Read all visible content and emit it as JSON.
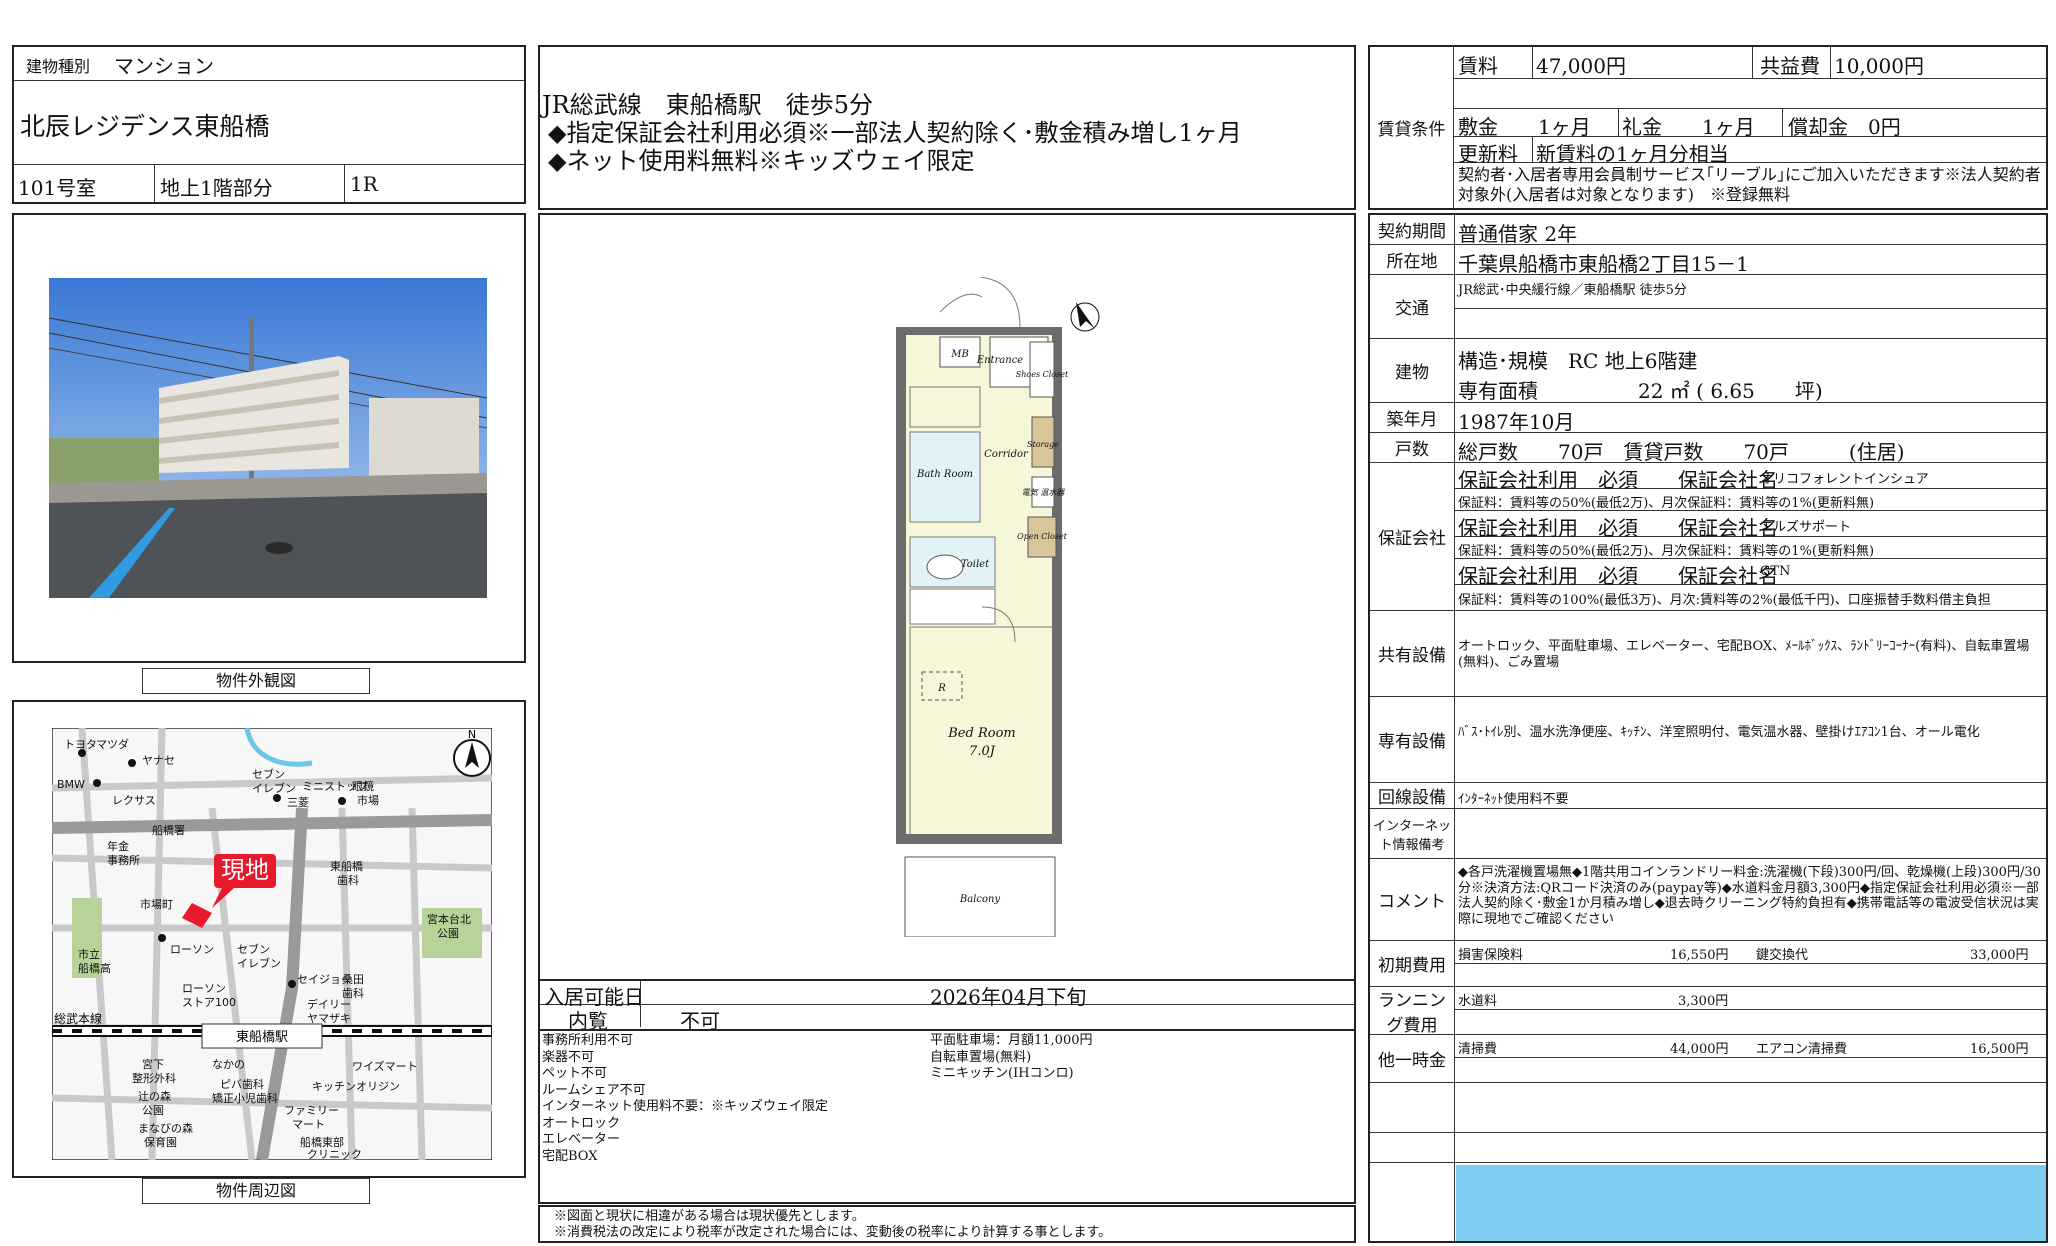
{
  "building": {
    "type_label": "建物種別",
    "type_value": "マンション",
    "name": "北辰レジデンス東船橋",
    "room": "101号室",
    "floor": "地上1階部分",
    "layout": "1R"
  },
  "access": {
    "line1": "JR総武線　東船橋駅　徒歩5分",
    "line2": "◆指定保証会社利用必須※一部法人契約除く･敷金積み増し1ヶ月",
    "line3": "◆ネット使用料無料※キッズウェイ限定"
  },
  "photo_caption": "物件外観図",
  "map_caption": "物件周辺図",
  "map": {
    "current_location": "現地",
    "station": "東船橋駅",
    "line": "総武本線",
    "labels": [
      "トヨタ",
      "マツダ",
      "ヤナセ",
      "BMW",
      "レクサス",
      "セブン イレブン",
      "三菱",
      "ミニ ストップ",
      "眼鏡 市場",
      "船橋署",
      "年金 事務所",
      "東船橋 歯科",
      "市場町",
      "宮本台北 公園",
      "市立 船橋高",
      "ローソン",
      "セブン イレブン",
      "ローソン ストア100",
      "セイジョー",
      "桑田 歯科",
      "デイリー ヤマザキ",
      "宮下 整形外科",
      "なかの",
      "ワイズマート",
      "ピバ歯科 矯正小児歯科",
      "キッチンオリジン",
      "辻の森 公園",
      "ファミリー マート",
      "まなびの森 保育園",
      "船橋東部 クリニック"
    ]
  },
  "floorplan": {
    "rooms": [
      "MB",
      "Entrance",
      "Shoes Closet",
      "Bath Room",
      "Corridor",
      "Storage",
      "電気 温水器",
      "Toilet",
      "Open Closet",
      "R",
      "Bed Room",
      "7.0J",
      "Balcony"
    ]
  },
  "availability": {
    "move_in_label": "入居可能日",
    "move_in_value": "2026年04月下旬",
    "viewing_label": "内覧",
    "viewing_value": "不可"
  },
  "notes_left": [
    "事務所利用不可",
    "楽器不可",
    "ペット不可",
    "ルームシェア不可",
    "インターネット使用料不要：※キッズウェイ限定",
    "オートロック",
    "エレベーター",
    "宅配BOX"
  ],
  "notes_right": [
    "平面駐車場：月額11,000円",
    "自転車置場(無料)",
    "ミニキッチン(IHコンロ)"
  ],
  "disclaimer": [
    "※図面と現状に相違がある場合は現状優先とします。",
    "※消費税法の改定により税率が改定された場合には、変動後の税率により計算する事とします。"
  ],
  "conditions": {
    "label": "賃貸条件",
    "rent_label": "賃料",
    "rent": "47,000円",
    "common_label": "共益費",
    "common": "10,000円",
    "deposit": "敷金　　1ヶ月",
    "key_money": "礼金　　1ヶ月",
    "amortization": "償却金　0円",
    "renewal_label": "更新料",
    "renewal": "新賃料の1ヶ月分相当",
    "member_note": "契約者･入居者専用会員制サービス｢リーブル｣にご加入いただきます※法人契約者対象外(入居者は対象となります)　※登録無料"
  },
  "details": {
    "period_label": "契約期間",
    "period": "普通借家 2年",
    "address_label": "所在地",
    "address": "千葉県船橋市東船橋2丁目15－1",
    "transport_label": "交通",
    "transport": "JR総武･中央緩行線／東船橋駅 徒歩5分",
    "building_label": "建物",
    "structure": "構造･規模　RC 地上6階建",
    "area": "専有面積　　　　　22 ㎡ ( 6.65　　坪)",
    "built_label": "築年月",
    "built": "1987年10月",
    "units_label": "戸数",
    "units": "総戸数　　70戸　賃貸戸数　　70戸　　　(住居)",
    "guarantee_label": "保証会社",
    "guarantees": [
      {
        "head": "保証会社利用　必須　　保証会社名",
        "name": "オリコフォレントインシュア",
        "fee": "保証料：賃料等の50%(最低2万)、月次保証料：賃料等の1%(更新料無)"
      },
      {
        "head": "保証会社利用　必須　　保証会社名",
        "name": "エルズサポート",
        "fee": "保証料：賃料等の50%(最低2万)、月次保証料：賃料等の1%(更新料無)"
      },
      {
        "head": "保証会社利用　必須　　保証会社名",
        "name": "GTN",
        "fee": "保証料：賃料等の100%(最低3万)、月次:賃料等の2%(最低千円)、口座振替手数料借主負担"
      }
    ],
    "shared_label": "共有設備",
    "shared": "オートロック、平面駐車場、エレベーター、宅配BOX、ﾒｰﾙﾎﾞｯｸｽ、ﾗﾝﾄﾞﾘｰｺｰﾅｰ(有料)、自転車置場(無料)、ごみ置場",
    "private_label": "専有設備",
    "private": "ﾊﾞｽ･ﾄｲﾚ別、温水洗浄便座、ｷｯﾁﾝ、洋室照明付、電気温水器、壁掛けｴｱｺﾝ1台、オール電化",
    "line_label": "回線設備",
    "line": "ｲﾝﾀｰﾈｯﾄ使用料不要",
    "internet_label": "インターネット情報備考",
    "internet": "",
    "comment_label": "コメント",
    "comment": "◆各戸洗濯機置場無◆1階共用コインランドリー料金:洗濯機(下段)300円/回、乾燥機(上段)300円/30分※決済方法:QRコード決済のみ(paypay等)◆水道料金月額3,300円◆指定保証会社利用必須※一部法人契約除く･敷金1か月積み増し◆退去時クリーニング特約負担有◆携帯電話等の電波受信状況は実際に現地でご確認ください",
    "initial_label": "初期費用",
    "initial_items": [
      {
        "name": "損害保険料",
        "value": "16,550円"
      },
      {
        "name": "鍵交換代",
        "value": "33,000円"
      }
    ],
    "running_label": "ランニング費用",
    "running_items": [
      {
        "name": "水道料",
        "value": "3,300円"
      }
    ],
    "onetime_label": "他一時金",
    "onetime_items": [
      {
        "name": "清掃費",
        "value": "44,000円"
      },
      {
        "name": "エアコン清掃費",
        "value": "16,500円"
      }
    ]
  },
  "colors": {
    "footer_blue": "#7ecdf0",
    "floor_yellow": "#f6f7d8",
    "wet_blue": "#e2f3f8",
    "map_red": "#e8192c"
  }
}
